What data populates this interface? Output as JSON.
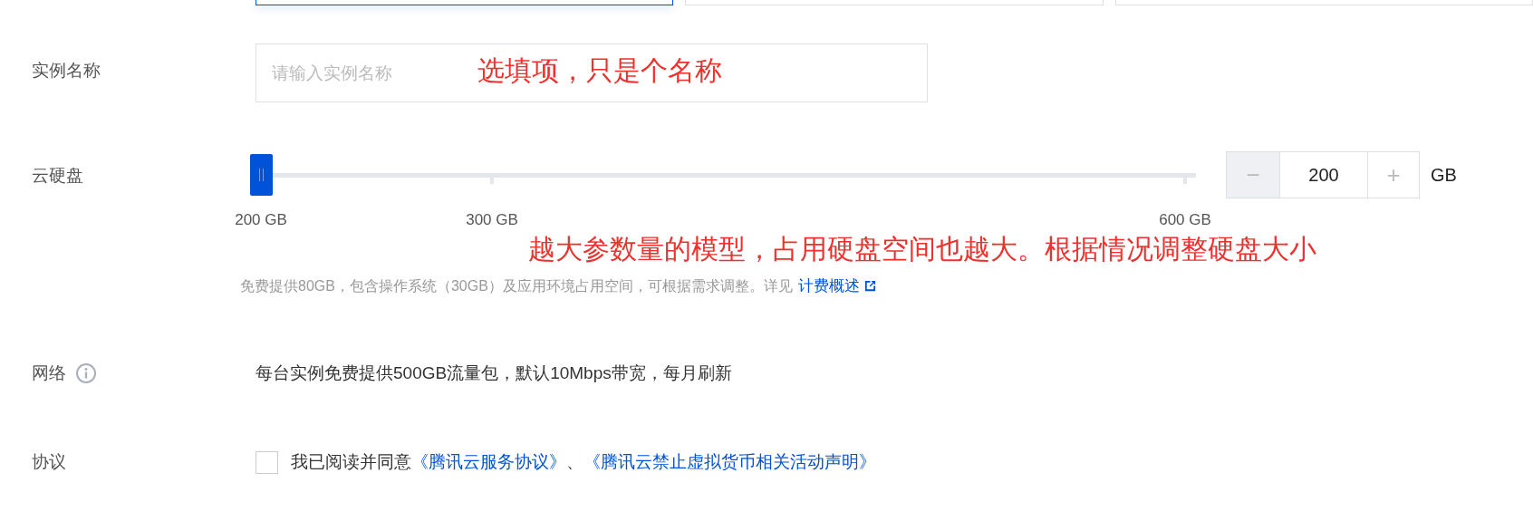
{
  "cards": [
    {
      "selected": true
    },
    {
      "selected": false
    },
    {
      "selected": false
    }
  ],
  "name_row": {
    "label": "实例名称",
    "placeholder": "请输入实例名称",
    "annotation": "选填项，只是个名称"
  },
  "disk_row": {
    "label": "云硬盘",
    "slider": {
      "ticks": [
        "200 GB",
        "300 GB",
        "600 GB"
      ]
    },
    "stepper": {
      "minus": "−",
      "value": "200",
      "plus": "+",
      "unit": "GB"
    },
    "annotation": "越大参数量的模型，占用硬盘空间也越大。根据情况调整硬盘大小",
    "hint": "免费提供80GB，包含操作系统（30GB）及应用环境占用空间，可根据需求调整。详见",
    "hint_link": "计费概述"
  },
  "network_row": {
    "label": "网络",
    "text": "每台实例免费提供500GB流量包，默认10Mbps带宽，每月刷新"
  },
  "agreement_row": {
    "label": "协议",
    "checked": false,
    "text": "我已阅读并同意",
    "links": [
      "《腾讯云服务协议》",
      "《腾讯云禁止虚拟货币相关活动声明》"
    ],
    "separator": "、"
  }
}
